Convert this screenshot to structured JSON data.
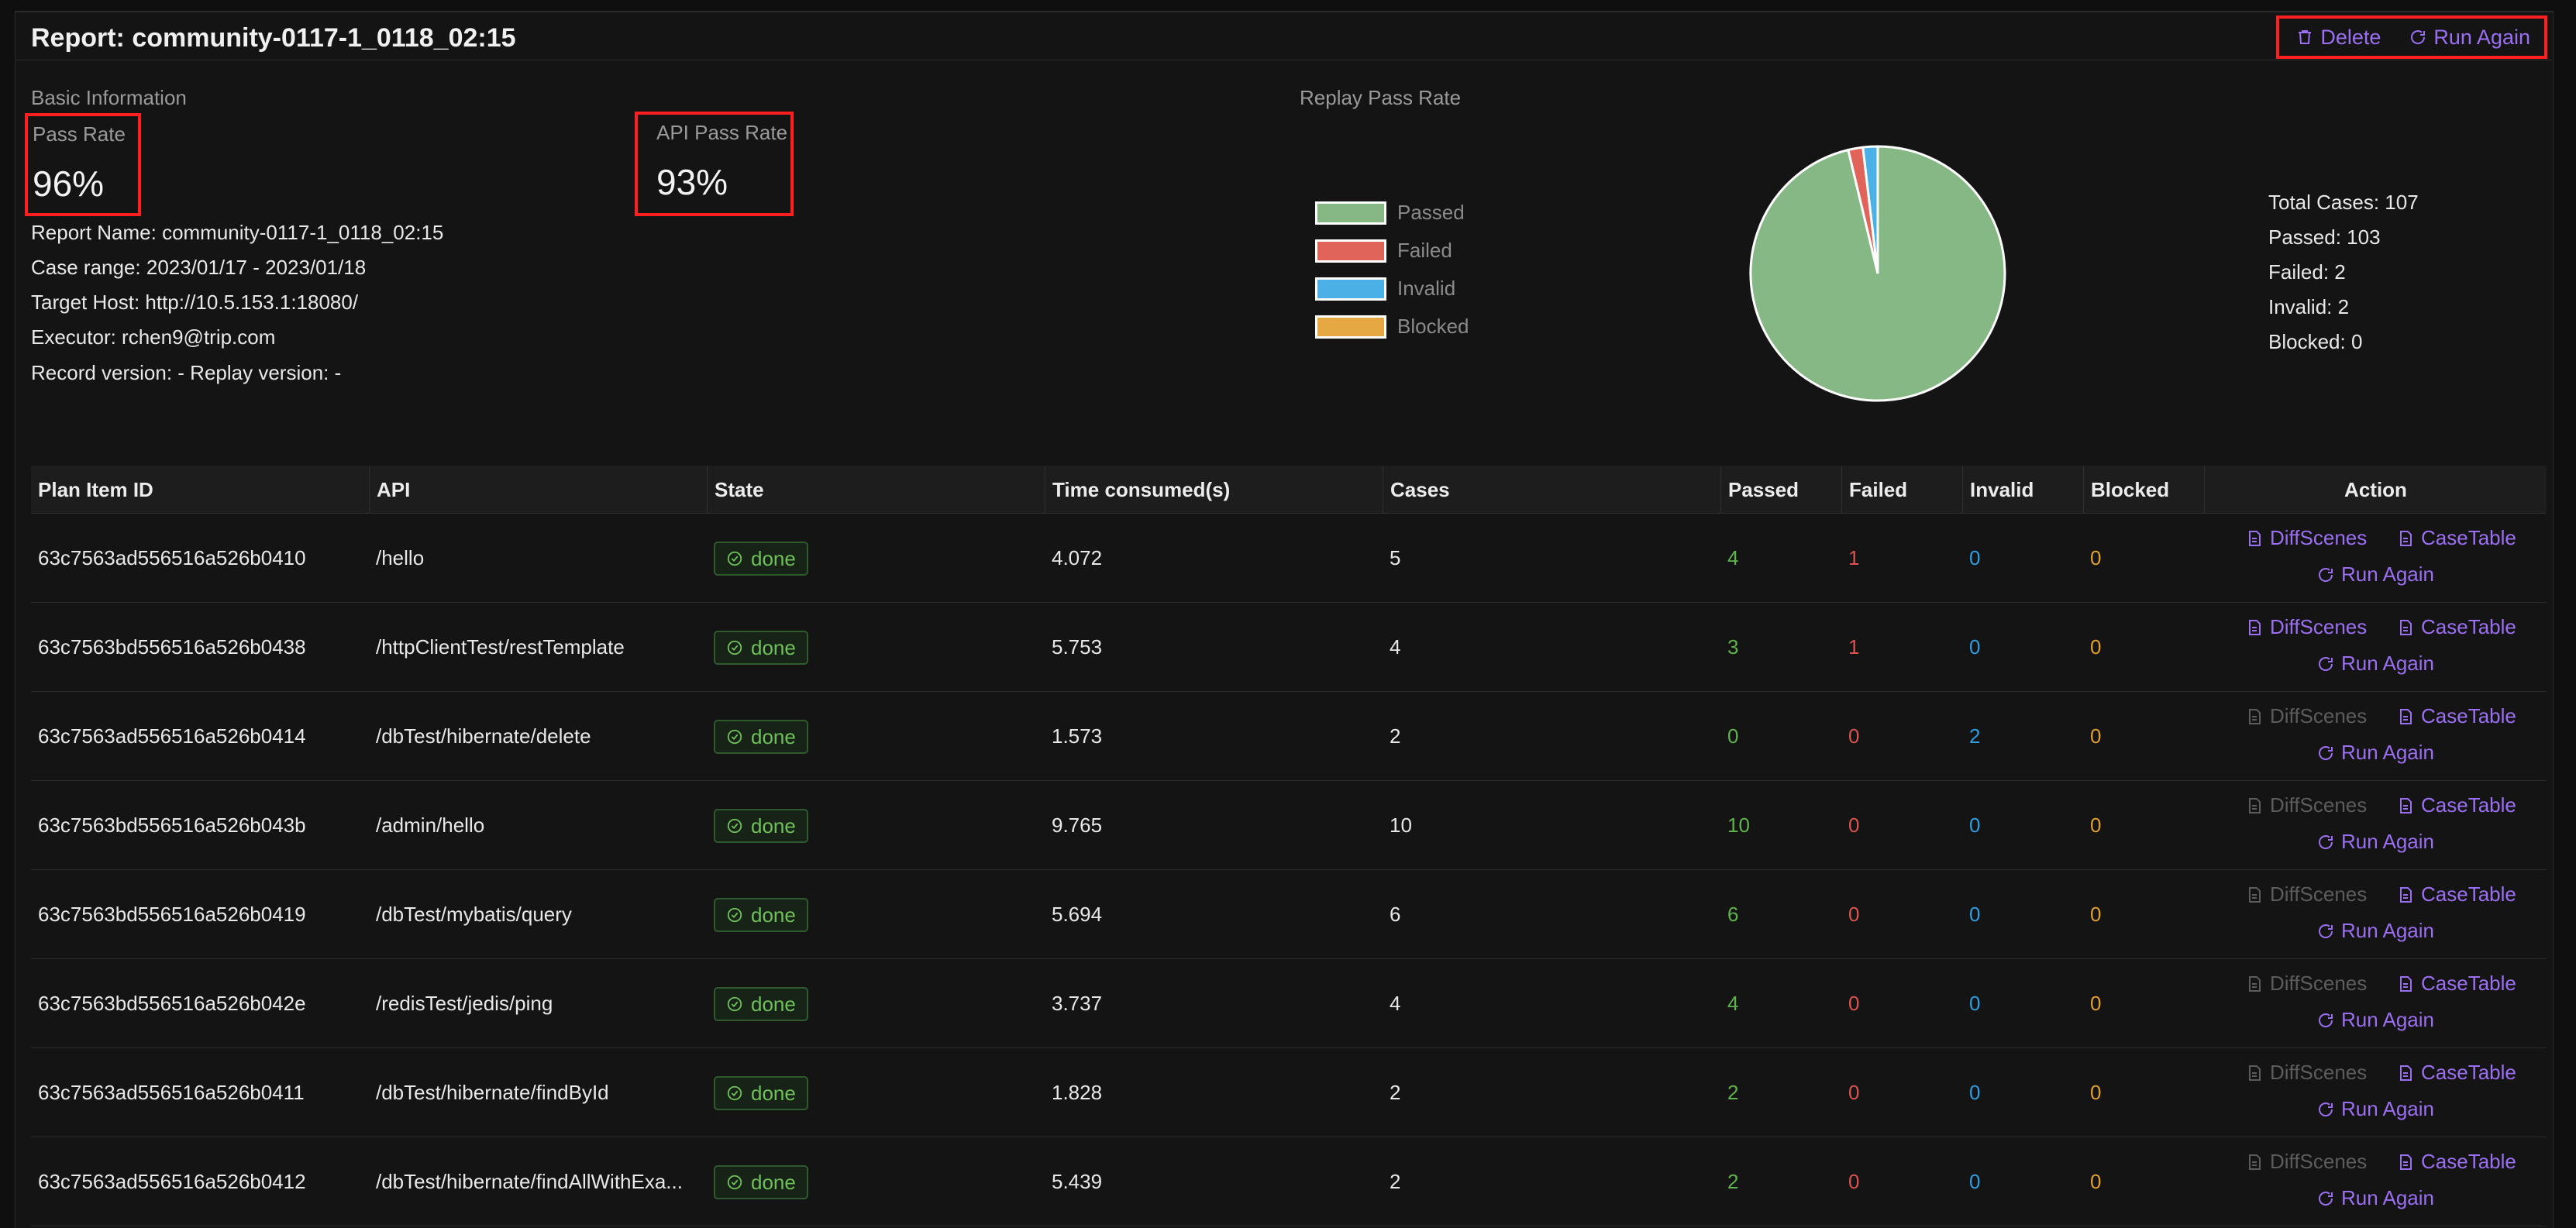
{
  "header": {
    "title": "Report: community-0117-1_0118_02:15",
    "delete_label": "Delete",
    "run_again_label": "Run Again"
  },
  "basic_info": {
    "section_title": "Basic Information",
    "pass_rate_label": "Pass Rate",
    "pass_rate_value": "96%",
    "api_pass_rate_label": "API Pass Rate",
    "api_pass_rate_value": "93%",
    "lines": [
      "Report Name: community-0117-1_0118_02:15",
      "Case range: 2023/01/17 - 2023/01/18",
      "Target Host: http://10.5.153.1:18080/",
      "Executor: rchen9@trip.com",
      "Record version: - Replay version: -"
    ]
  },
  "replay": {
    "section_title": "Replay Pass Rate",
    "legend": [
      {
        "label": "Passed",
        "color": "#86b886"
      },
      {
        "label": "Failed",
        "color": "#e0645a"
      },
      {
        "label": "Invalid",
        "color": "#4ab0e6"
      },
      {
        "label": "Blocked",
        "color": "#e6a843"
      }
    ],
    "summary": [
      "Total Cases: 107",
      "Passed: 103",
      "Failed: 2",
      "Invalid: 2",
      "Blocked: 0"
    ]
  },
  "chart_data": {
    "type": "pie",
    "categories": [
      "Passed",
      "Failed",
      "Invalid",
      "Blocked"
    ],
    "values": [
      103,
      2,
      2,
      0
    ],
    "colors": [
      "#86b886",
      "#e0645a",
      "#4ab0e6",
      "#e6a843"
    ],
    "title": "Replay Pass Rate",
    "legend_position": "left"
  },
  "table": {
    "columns": [
      "Plan Item ID",
      "API",
      "State",
      "Time consumed(s)",
      "Cases",
      "Passed",
      "Failed",
      "Invalid",
      "Blocked",
      "Action"
    ],
    "action_labels": {
      "diff": "DiffScenes",
      "case_table": "CaseTable",
      "run_again": "Run Again"
    },
    "rows": [
      {
        "id": "63c7563ad556516a526b0410",
        "api": "/hello",
        "state": "done",
        "time": "4.072",
        "cases": "5",
        "passed": "4",
        "failed": "1",
        "invalid": "0",
        "blocked": "0",
        "diff_enabled": true
      },
      {
        "id": "63c7563bd556516a526b0438",
        "api": "/httpClientTest/restTemplate",
        "state": "done",
        "time": "5.753",
        "cases": "4",
        "passed": "3",
        "failed": "1",
        "invalid": "0",
        "blocked": "0",
        "diff_enabled": true
      },
      {
        "id": "63c7563ad556516a526b0414",
        "api": "/dbTest/hibernate/delete",
        "state": "done",
        "time": "1.573",
        "cases": "2",
        "passed": "0",
        "failed": "0",
        "invalid": "2",
        "blocked": "0",
        "diff_enabled": false
      },
      {
        "id": "63c7563bd556516a526b043b",
        "api": "/admin/hello",
        "state": "done",
        "time": "9.765",
        "cases": "10",
        "passed": "10",
        "failed": "0",
        "invalid": "0",
        "blocked": "0",
        "diff_enabled": false
      },
      {
        "id": "63c7563bd556516a526b0419",
        "api": "/dbTest/mybatis/query",
        "state": "done",
        "time": "5.694",
        "cases": "6",
        "passed": "6",
        "failed": "0",
        "invalid": "0",
        "blocked": "0",
        "diff_enabled": false
      },
      {
        "id": "63c7563bd556516a526b042e",
        "api": "/redisTest/jedis/ping",
        "state": "done",
        "time": "3.737",
        "cases": "4",
        "passed": "4",
        "failed": "0",
        "invalid": "0",
        "blocked": "0",
        "diff_enabled": false
      },
      {
        "id": "63c7563ad556516a526b0411",
        "api": "/dbTest/hibernate/findById",
        "state": "done",
        "time": "1.828",
        "cases": "2",
        "passed": "2",
        "failed": "0",
        "invalid": "0",
        "blocked": "0",
        "diff_enabled": false
      },
      {
        "id": "63c7563ad556516a526b0412",
        "api": "/dbTest/hibernate/findAllWithExa...",
        "state": "done",
        "time": "5.439",
        "cases": "2",
        "passed": "2",
        "failed": "0",
        "invalid": "0",
        "blocked": "0",
        "diff_enabled": false
      }
    ]
  }
}
